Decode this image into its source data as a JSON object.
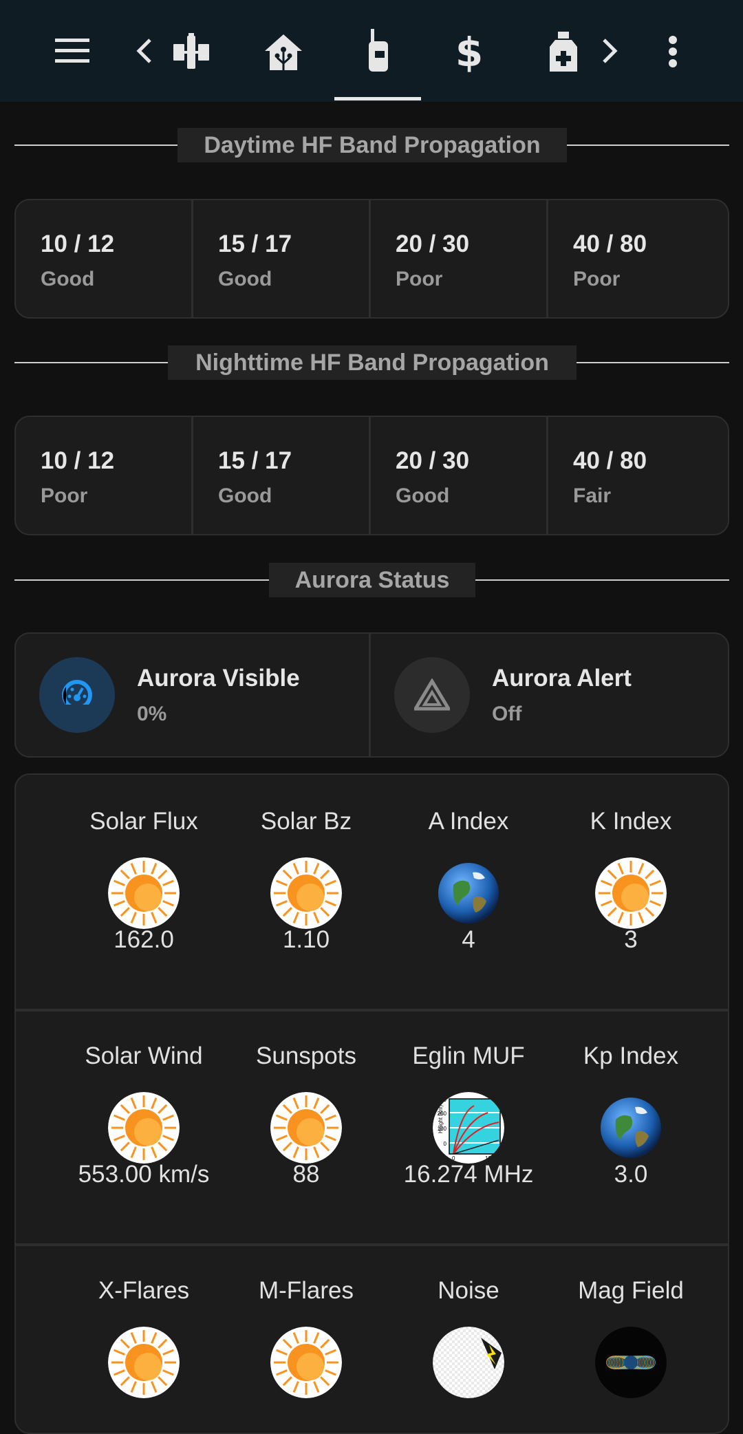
{
  "header": {
    "icons": [
      "menu-icon",
      "chevron-left-icon",
      "satellite-icon",
      "home-assistant-icon",
      "radio-icon",
      "dollar-icon",
      "medical-bag-icon",
      "chevron-right-icon",
      "more-vertical-icon"
    ],
    "active_tab": "radio-icon"
  },
  "daytime": {
    "title": "Daytime HF Band Propagation",
    "bands": [
      {
        "name": "10 / 12",
        "status": "Good"
      },
      {
        "name": "15 / 17",
        "status": "Good"
      },
      {
        "name": "20 / 30",
        "status": "Poor"
      },
      {
        "name": "40 / 80",
        "status": "Poor"
      }
    ]
  },
  "nighttime": {
    "title": "Nighttime HF Band Propagation",
    "bands": [
      {
        "name": "10 / 12",
        "status": "Poor"
      },
      {
        "name": "15 / 17",
        "status": "Good"
      },
      {
        "name": "20 / 30",
        "status": "Good"
      },
      {
        "name": "40 / 80",
        "status": "Fair"
      }
    ]
  },
  "aurora": {
    "title": "Aurora Status",
    "visible": {
      "name": "Aurora Visible",
      "value": "0%",
      "icon": "gauge-icon",
      "accent": "#2196f3"
    },
    "alert": {
      "name": "Aurora Alert",
      "value": "Off",
      "icon": "alert-triangle-icon"
    }
  },
  "stats": [
    [
      {
        "label": "Solar Flux",
        "value": "162.0",
        "icon": "sun-icon"
      },
      {
        "label": "Solar Bz",
        "value": "1.10",
        "icon": "sun-icon"
      },
      {
        "label": "A Index",
        "value": "4",
        "icon": "earth-icon"
      },
      {
        "label": "K Index",
        "value": "3",
        "icon": "sun-icon"
      }
    ],
    [
      {
        "label": "Solar Wind",
        "value": "553.00 km/s",
        "icon": "sun-icon"
      },
      {
        "label": "Sunspots",
        "value": "88",
        "icon": "sun-icon"
      },
      {
        "label": "Eglin MUF",
        "value": "16.274 MHz",
        "icon": "muf-chart-icon"
      },
      {
        "label": "Kp Index",
        "value": "3.0",
        "icon": "earth-icon"
      }
    ],
    [
      {
        "label": "X-Flares",
        "value": "",
        "icon": "sun-icon"
      },
      {
        "label": "M-Flares",
        "value": "",
        "icon": "sun-icon"
      },
      {
        "label": "Noise",
        "value": "",
        "icon": "noise-icon"
      },
      {
        "label": "Mag Field",
        "value": "",
        "icon": "magnetic-field-icon"
      }
    ]
  ],
  "muf_chart_text": {
    "ylabel": "Height (km)",
    "yticks": [
      "300",
      "200",
      "100",
      "0"
    ],
    "xticks": [
      "0",
      "1000"
    ]
  },
  "colors": {
    "background": "#111111",
    "topbar": "#0f1c24",
    "card": "#1c1c1c",
    "sun": "#f7931e"
  }
}
